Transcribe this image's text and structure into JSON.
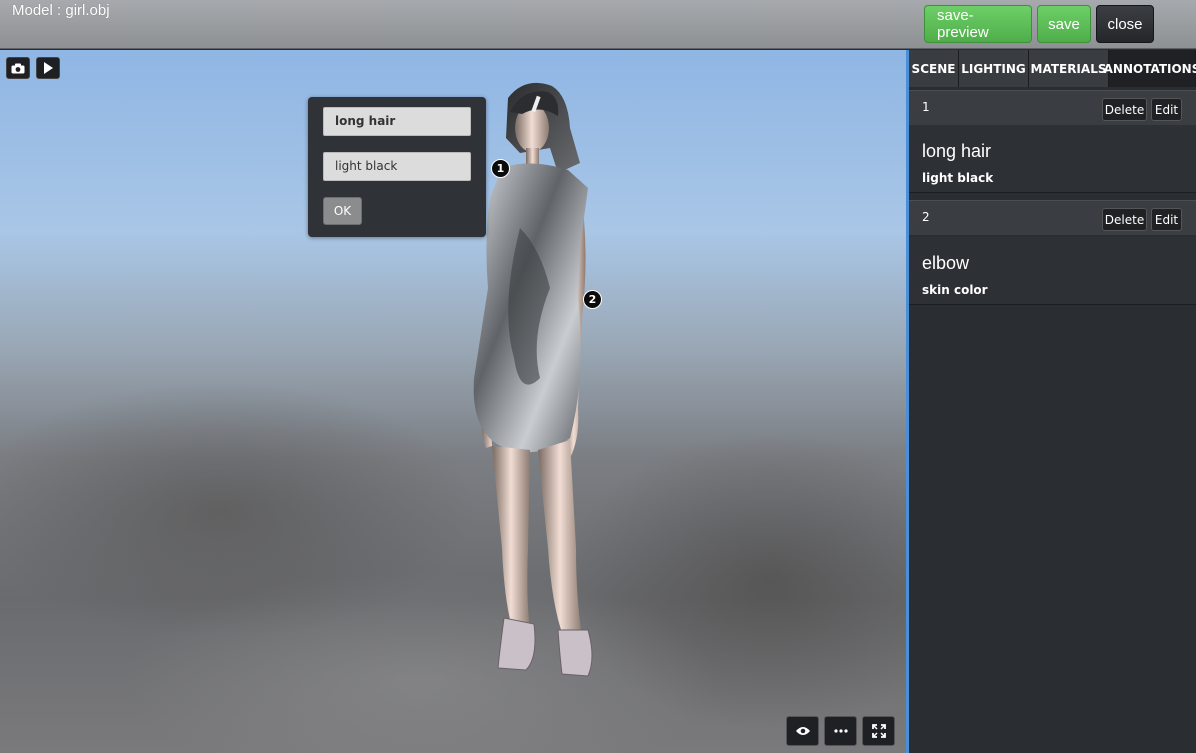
{
  "header": {
    "model_title": "Model : girl.obj",
    "save_preview_label": "save-preview",
    "save_label": "save",
    "close_label": "close"
  },
  "viewport": {
    "tools": [
      "camera-icon",
      "play-icon"
    ],
    "bottom_controls": [
      "eye-icon",
      "more-icon",
      "fullscreen-icon"
    ]
  },
  "popup": {
    "title_value": "long hair",
    "description_value": "light black",
    "ok_label": "OK"
  },
  "markers": [
    "1",
    "2"
  ],
  "panel": {
    "tabs": [
      {
        "label": "SCENE"
      },
      {
        "label": "LIGHTING"
      },
      {
        "label": "MATERIALS"
      },
      {
        "label": "ANNOTATIONS"
      }
    ],
    "active_tab": "ANNOTATIONS",
    "annotations": [
      {
        "number": "1",
        "title": "long hair",
        "description": "light black",
        "delete_label": "Delete",
        "edit_label": "Edit"
      },
      {
        "number": "2",
        "title": "elbow",
        "description": "skin color",
        "delete_label": "Delete",
        "edit_label": "Edit"
      }
    ]
  },
  "colors": {
    "accent_green": "#5cbf57",
    "panel_border": "#4a8fd8",
    "dark": "#2a2d31"
  }
}
